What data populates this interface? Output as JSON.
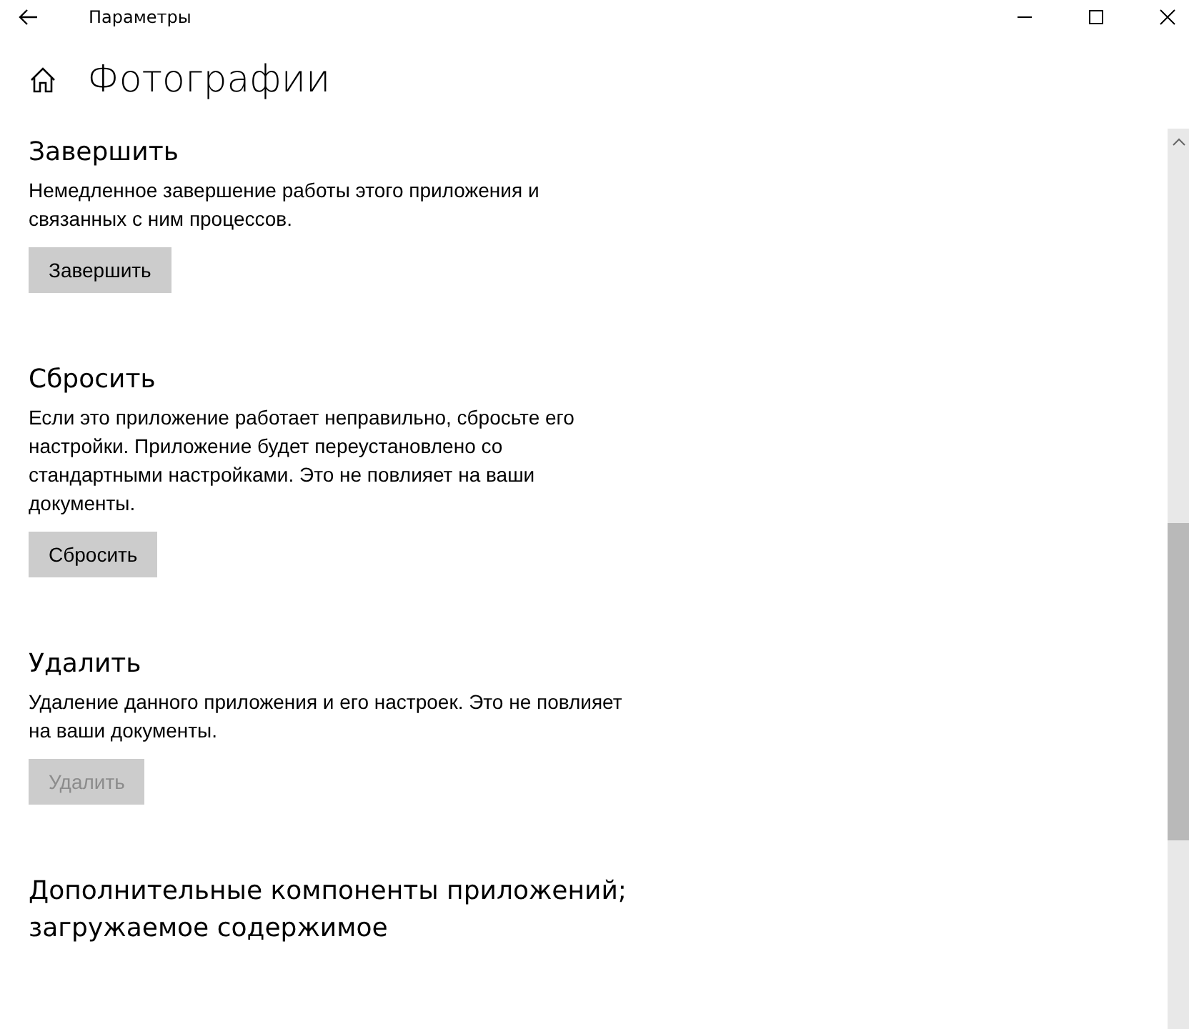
{
  "window": {
    "title": "Параметры"
  },
  "page": {
    "title": "Фотографии"
  },
  "sections": [
    {
      "heading": "Завершить",
      "description": "Немедленное завершение работы этого приложения и\nсвязанных с ним процессов.",
      "button": {
        "label": "Завершить",
        "disabled": false
      }
    },
    {
      "heading": "Сбросить",
      "description": "Если это приложение работает неправильно, сбросьте его\nнастройки. Приложение будет переустановлено со\nстандартными настройками. Это не повлияет на ваши\nдокументы.",
      "button": {
        "label": "Сбросить",
        "disabled": false
      }
    },
    {
      "heading": "Удалить",
      "description": "Удаление данного приложения и его настроек. Это не повлияет\nна ваши документы.",
      "button": {
        "label": "Удалить",
        "disabled": true
      }
    },
    {
      "heading": "Дополнительные компоненты приложений;\nзагружаемое содержимое"
    }
  ]
}
